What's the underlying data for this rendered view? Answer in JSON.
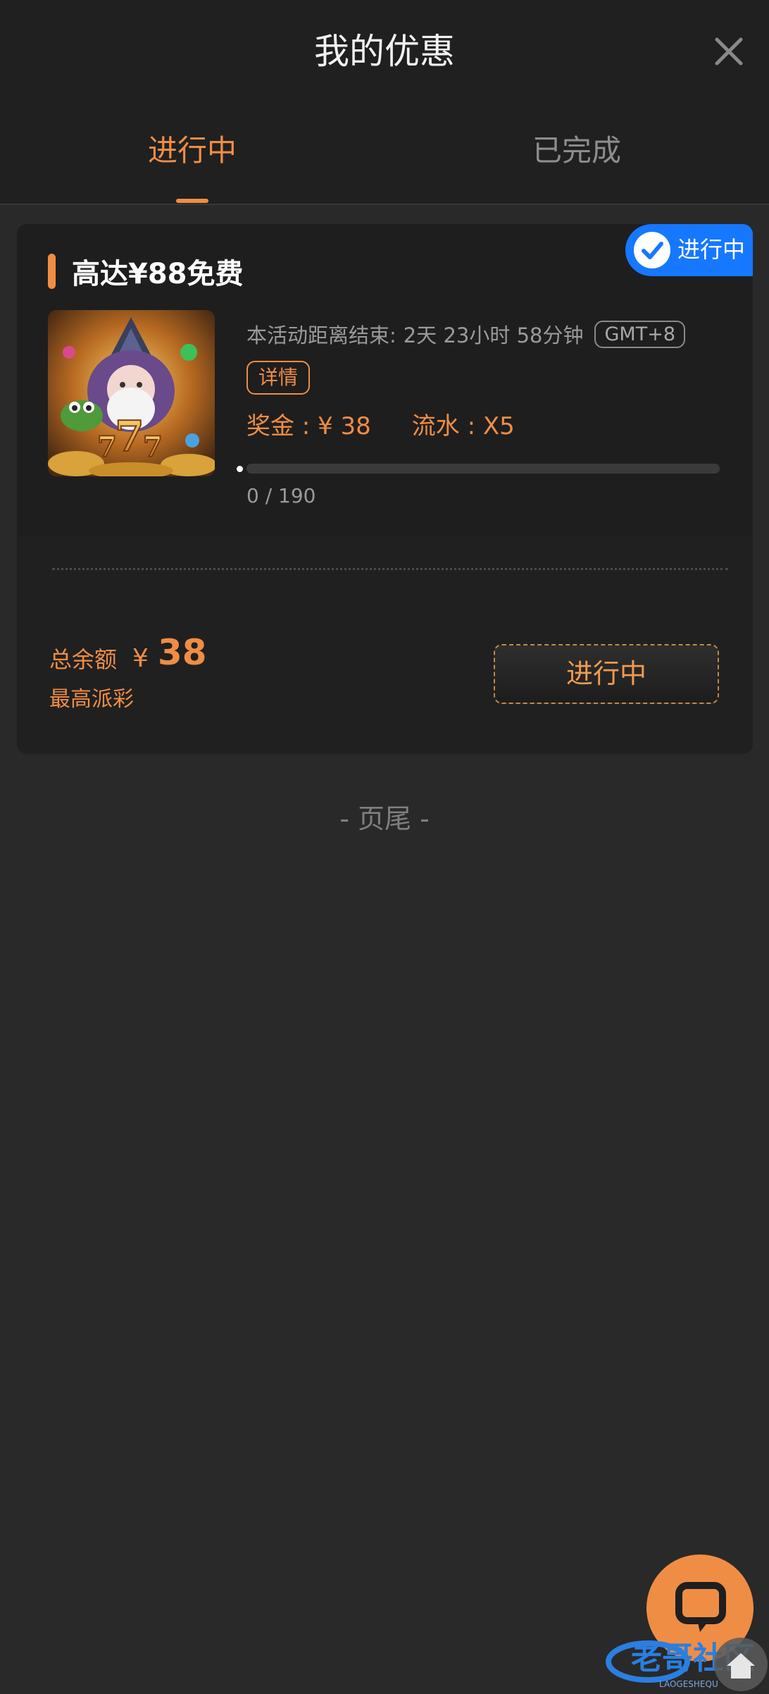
{
  "header": {
    "title": "我的优惠",
    "tabs": [
      {
        "label": "进行中",
        "active": true
      },
      {
        "label": "已完成",
        "active": false
      }
    ]
  },
  "promo": {
    "status_badge": "进行中",
    "title": "高达¥88免费",
    "countdown_label": "本活动距离结束:",
    "countdown_value": "2天 23小时 58分钟",
    "timezone": "GMT+8",
    "details_label": "详情",
    "bonus_label": "奖金 : ¥ 38",
    "wager_label": "流水 : X5",
    "progress": {
      "current": 0,
      "total": 190,
      "text": "0 / 190"
    },
    "balance_label": "总余额",
    "balance_currency": "¥",
    "balance_amount": "38",
    "max_payout_label": "最高派彩",
    "action_label": "进行中"
  },
  "footer": {
    "text": "- 页尾 -"
  },
  "watermark": {
    "text": "老哥社区",
    "subtext": "LAOGESHEQU"
  },
  "colors": {
    "background": "#292929",
    "header": "#202020",
    "accent": "#ef8d45",
    "badge": "#1677ff",
    "muted_text": "#9a9a9a"
  },
  "icons": {
    "close": "close-icon",
    "check": "check-icon",
    "chat": "chat-icon",
    "game_thumbnail": "wizard-slot-thumbnail"
  }
}
